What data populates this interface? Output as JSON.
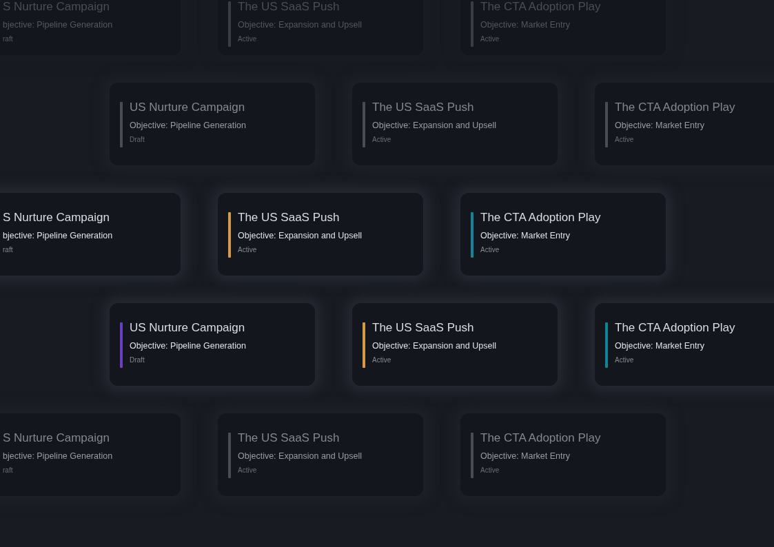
{
  "rows": [
    {
      "kind": "faint",
      "cards": [
        {
          "title": "S Nurture Campaign",
          "objective": "bjective: Pipeline Generation",
          "status": "raft"
        },
        {
          "title": "The US SaaS Push",
          "objective": "Objective: Expansion and Upsell",
          "status": "Active"
        },
        {
          "title": "The CTA Adoption Play",
          "objective": "Objective: Market Entry",
          "status": "Active"
        }
      ]
    },
    {
      "kind": "dim",
      "cards": [
        {
          "title": "US Nurture Campaign",
          "objective": "Objective: Pipeline Generation",
          "status": "Draft"
        },
        {
          "title": "The US SaaS Push",
          "objective": "Objective: Expansion and Upsell",
          "status": "Active"
        },
        {
          "title": "The CTA Adoption Play",
          "objective": "Objective: Market Entry",
          "status": "Active"
        }
      ]
    },
    {
      "kind": "full",
      "cards": [
        {
          "title": "S Nurture Campaign",
          "objective": "bjective: Pipeline Generation",
          "status": "raft"
        },
        {
          "title": "The US SaaS Push",
          "objective": "Objective: Expansion and Upsell",
          "status": "Active",
          "color": "#d69a44"
        },
        {
          "title": "The CTA Adoption Play",
          "objective": "Objective: Market Entry",
          "status": "Active",
          "color": "#12849a"
        }
      ]
    },
    {
      "kind": "full",
      "cards": [
        {
          "title": "US Nurture Campaign",
          "objective": "Objective: Pipeline Generation",
          "status": "Draft",
          "color": "#6a3fc0"
        },
        {
          "title": "The US SaaS Push",
          "objective": "Objective: Expansion and Upsell",
          "status": "Active",
          "color": "#d69a44"
        },
        {
          "title": "The CTA Adoption Play",
          "objective": "Objective: Market Entry",
          "status": "Active",
          "color": "#12849a"
        }
      ]
    },
    {
      "kind": "dim",
      "cards": [
        {
          "title": "S Nurture Campaign",
          "objective": "bjective: Pipeline Generation",
          "status": "raft"
        },
        {
          "title": "The US SaaS Push",
          "objective": "Objective: Expansion and Upsell",
          "status": "Active"
        },
        {
          "title": "The CTA Adoption Play",
          "objective": "Objective: Market Entry",
          "status": "Active"
        }
      ]
    }
  ]
}
